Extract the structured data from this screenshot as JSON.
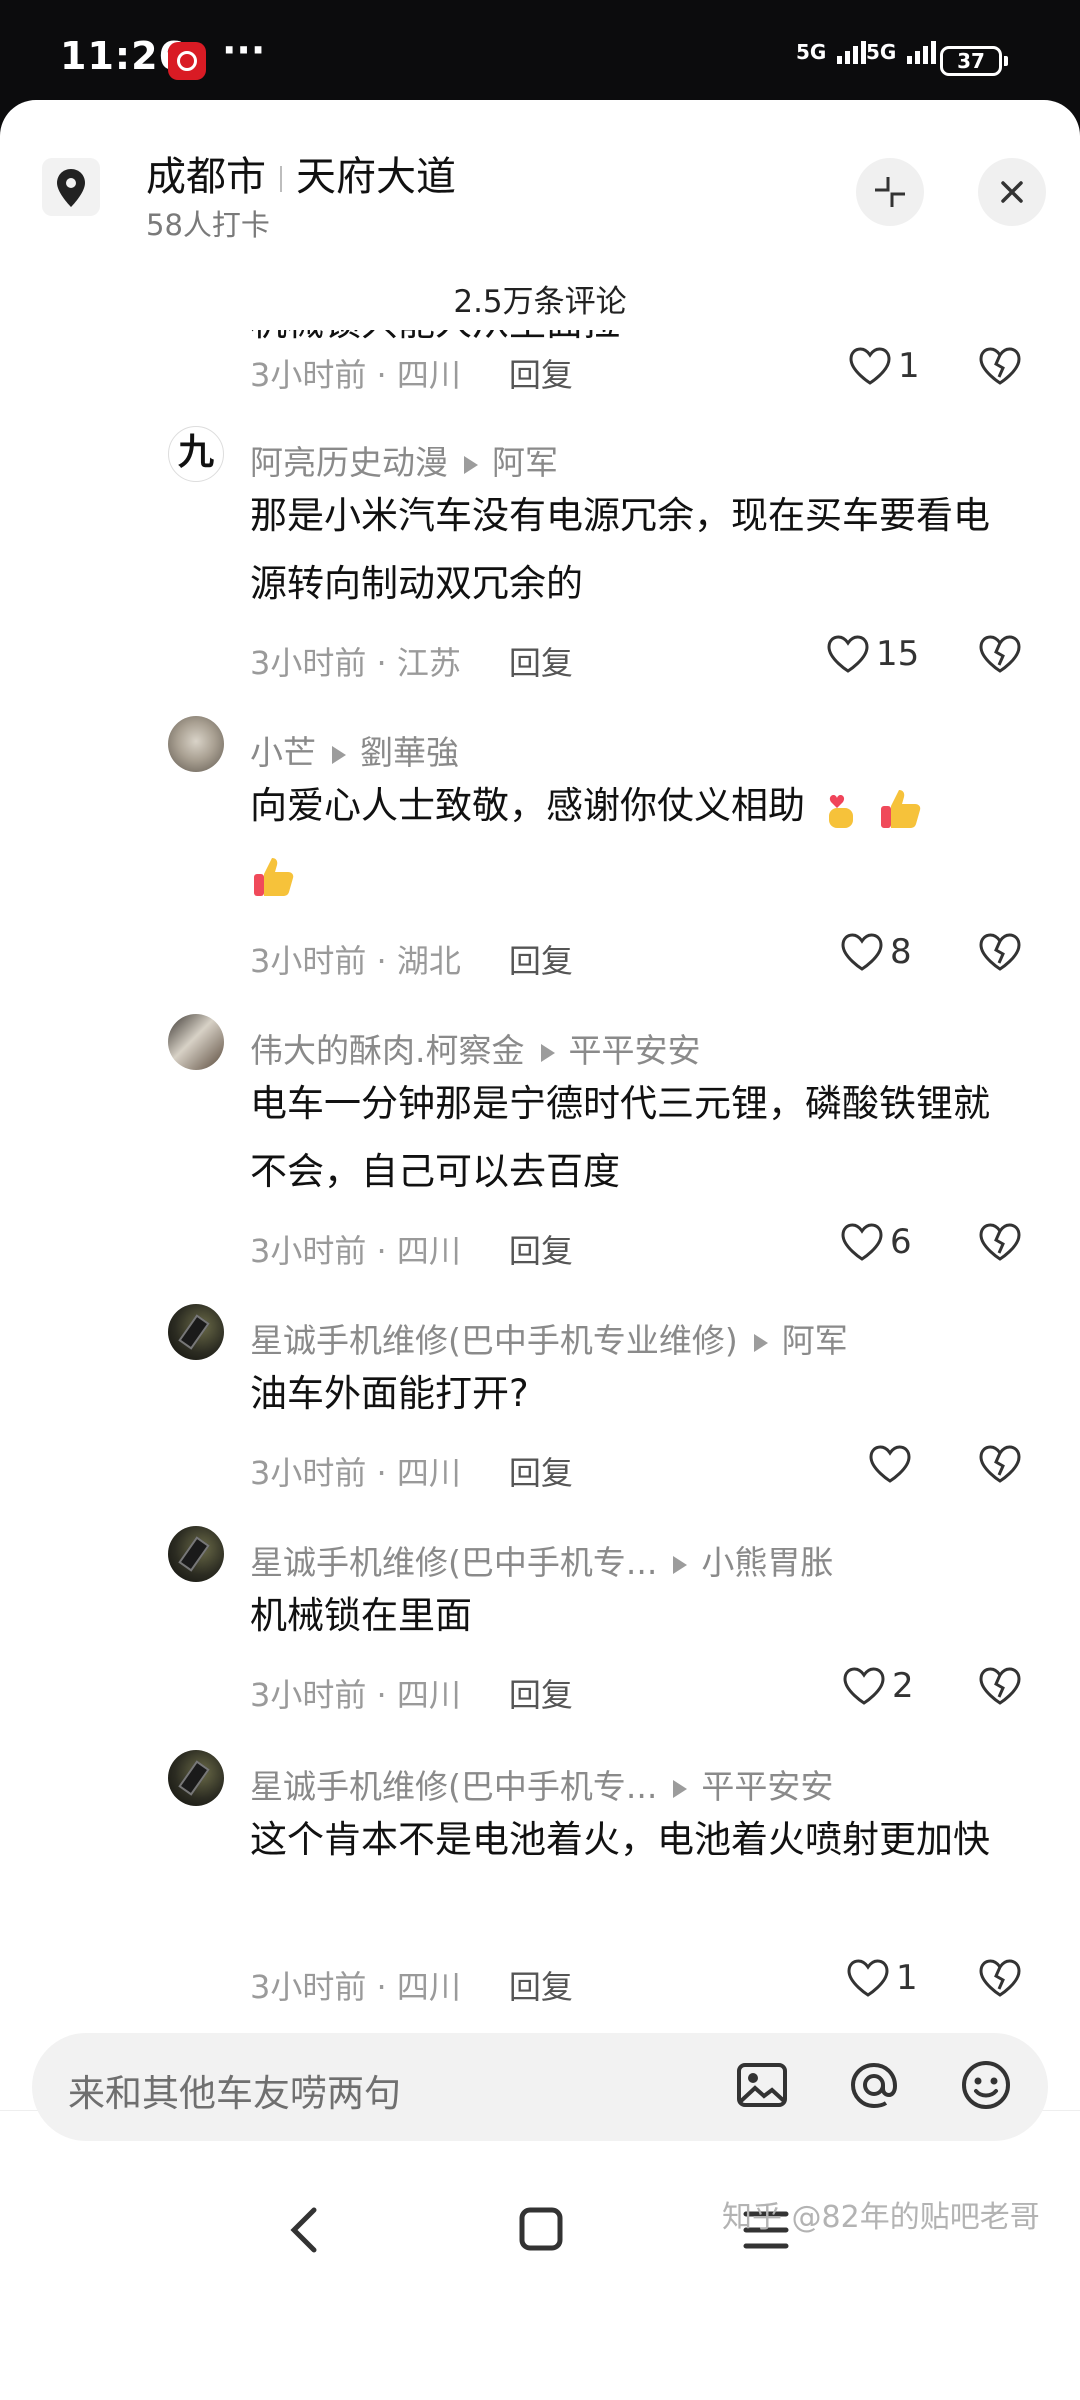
{
  "status_bar": {
    "time": "11:26",
    "dots": "···",
    "network1": "5G",
    "network2": "5G",
    "battery": "37"
  },
  "header": {
    "city": "成都市",
    "street": "天府大道",
    "checkins": "58人打卡",
    "comment_count": "2.5万条评论"
  },
  "clipped_text": "机械锁只能人从里面拉",
  "first_meta": {
    "time": "3小时前",
    "region": "四川",
    "reply": "回复",
    "likes": "1"
  },
  "comments": [
    {
      "avatar": "九",
      "user": "阿亮历史动漫",
      "reply_to": "阿军",
      "text": "那是小米汽车没有电源冗余，现在买车要看电源转向制动双冗余的",
      "time": "3小时前",
      "region": "江苏",
      "reply": "回复",
      "likes": "15"
    },
    {
      "user": "小芒",
      "reply_to": "劉華強",
      "text": "向爱心人士致敬，感谢你仗义相助",
      "time": "3小时前",
      "region": "湖北",
      "reply": "回复",
      "likes": "8"
    },
    {
      "user": "伟大的酥肉.柯察金",
      "reply_to": "平平安安",
      "text": "电车一分钟那是宁德时代三元锂，磷酸铁锂就不会，自己可以去百度",
      "time": "3小时前",
      "region": "四川",
      "reply": "回复",
      "likes": "6"
    },
    {
      "user": "星诚手机维修(巴中手机专业维修)",
      "reply_to": "阿军",
      "text": "油车外面能打开?",
      "time": "3小时前",
      "region": "四川",
      "reply": "回复",
      "likes": ""
    },
    {
      "user": "星诚手机维修(巴中手机专...",
      "reply_to": "小熊胃胀",
      "text": "机械锁在里面",
      "time": "3小时前",
      "region": "四川",
      "reply": "回复",
      "likes": "2"
    },
    {
      "user": "星诚手机维修(巴中手机专...",
      "reply_to": "平平安安",
      "text": "这个肯本不是电池着火，电池着火喷射更加快",
      "time": "3小时前",
      "region": "四川",
      "reply": "回复",
      "likes": "1"
    }
  ],
  "input": {
    "placeholder": "来和其他车友唠两句"
  },
  "icons": {
    "location": "location-pin-icon",
    "collapse": "collapse-icon",
    "close": "close-icon",
    "like": "heart-icon",
    "dislike": "broken-heart-icon",
    "image": "image-icon",
    "mention": "at-icon",
    "emoji": "smiley-icon"
  },
  "watermark": "知乎 @82年的贴吧老哥",
  "colors": {
    "accent": "#d91b24",
    "text": "#111111",
    "muted": "#8a8a8a"
  }
}
